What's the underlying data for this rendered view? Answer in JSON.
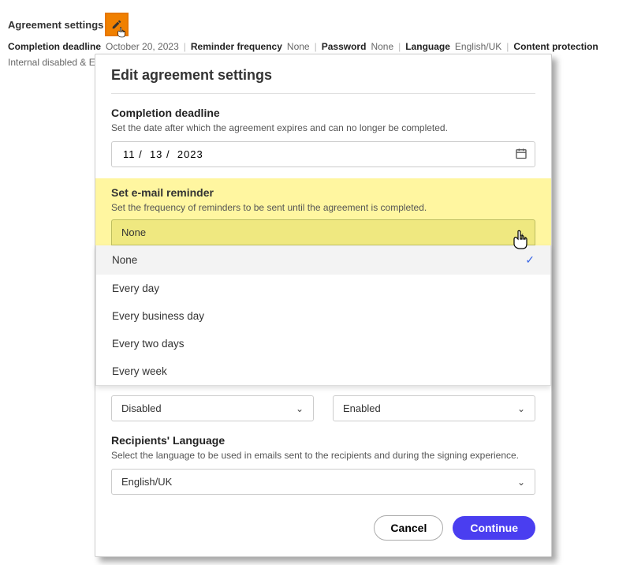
{
  "header": {
    "title": "Agreement settings",
    "summary": {
      "completion_deadline_label": "Completion deadline",
      "completion_deadline_value": "October 20, 2023",
      "reminder_label": "Reminder frequency",
      "reminder_value": "None",
      "password_label": "Password",
      "password_value": "None",
      "language_label": "Language",
      "language_value": "English/UK",
      "content_protection_label": "Content protection",
      "content_protection_value": "Internal disabled & External enabled"
    }
  },
  "dialog": {
    "title": "Edit agreement settings",
    "completion": {
      "title": "Completion deadline",
      "desc": "Set the date after which the agreement expires and can no longer be completed.",
      "date_value": "11 /  13 /  2023"
    },
    "reminder": {
      "title": "Set e-mail reminder",
      "desc": "Set the frequency of reminders to be sent until the agreement is completed.",
      "selected": "None",
      "options": [
        "None",
        "Every day",
        "Every business day",
        "Every two days",
        "Every week"
      ]
    },
    "protection": {
      "left_value": "Disabled",
      "right_value": "Enabled"
    },
    "language": {
      "title": "Recipients' Language",
      "desc": "Select the language to be used in emails sent to the recipients and during the signing experience.",
      "value": "English/UK"
    },
    "footer": {
      "cancel": "Cancel",
      "continue": "Continue"
    }
  }
}
